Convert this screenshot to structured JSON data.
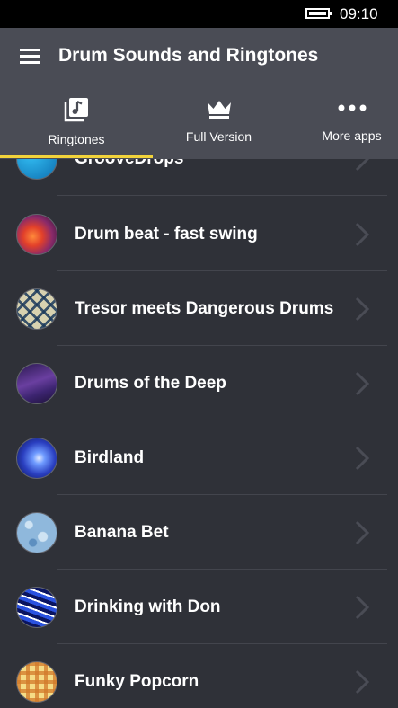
{
  "status_bar": {
    "time": "09:10",
    "battery_icon": "battery-icon"
  },
  "header": {
    "title": "Drum Sounds and Ringtones",
    "menu_icon": "hamburger-menu-icon"
  },
  "tabs": [
    {
      "label": "Ringtones",
      "icon": "music-library-icon",
      "selected": true
    },
    {
      "label": "Full Version",
      "icon": "crown-icon",
      "selected": false
    },
    {
      "label": "More apps",
      "icon": "more-dots-icon",
      "selected": false
    }
  ],
  "accent_color": "#f2d33b",
  "ringtones": [
    {
      "title": "GrooveDrops",
      "thumb_colors": [
        "#1aa0e0",
        "#0d6fb0"
      ]
    },
    {
      "title": "Drum beat - fast swing",
      "thumb_colors": [
        "#e2402a",
        "#6a2a8a"
      ]
    },
    {
      "title": "Tresor meets Dangerous Drums",
      "thumb_colors": [
        "#d8d2b0",
        "#1c3a5c"
      ]
    },
    {
      "title": "Drums of the Deep",
      "thumb_colors": [
        "#6a3fa0",
        "#2a1850"
      ]
    },
    {
      "title": "Birdland",
      "thumb_colors": [
        "#4f7cff",
        "#141a6a"
      ]
    },
    {
      "title": "Banana Bet",
      "thumb_colors": [
        "#9cc3e4",
        "#4f86b8"
      ]
    },
    {
      "title": "Drinking with Don",
      "thumb_colors": [
        "#2a52e0",
        "#0a1460"
      ]
    },
    {
      "title": "Funky Popcorn",
      "thumb_colors": [
        "#f0c04a",
        "#d27a2a"
      ]
    }
  ]
}
